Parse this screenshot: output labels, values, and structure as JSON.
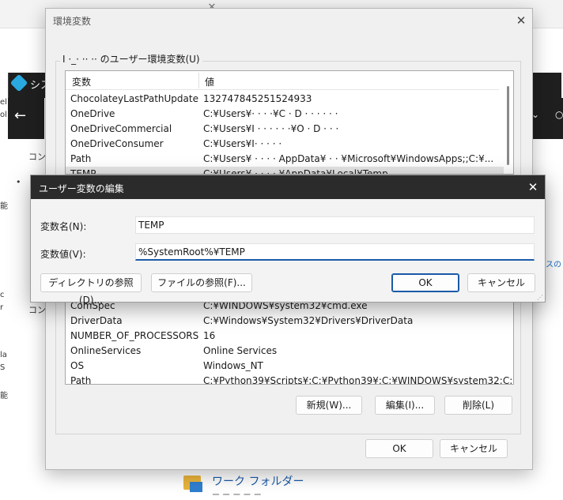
{
  "background": {
    "system_title": "シス",
    "link_con": "コン",
    "link_con2": "コン",
    "bullet": "•",
    "right_link": "スの",
    "edge_texts": [
      "el",
      "ol",
      "能",
      "c",
      "r",
      "la",
      "S",
      "能"
    ],
    "work_folder": "ワーク フォルダー",
    "work_folder_sub": "ー ー ー ー ー"
  },
  "env_dialog": {
    "title": "環境変数",
    "user_group_label": "I ·_· ·· ·· のユーザー環境変数(U)",
    "user_columns": {
      "name": "変数",
      "value": "値"
    },
    "user_vars": [
      {
        "name": "ChocolateyLastPathUpdate",
        "value": "132747845251524933"
      },
      {
        "name": "OneDrive",
        "value": "C:¥Users¥·   ·   ·  ·¥C ·  D · ·  · ·  ·  ·"
      },
      {
        "name": "OneDriveCommercial",
        "value": "C:¥Users¥I · ·  · ·  · ·¥O · D ·  ·  ·"
      },
      {
        "name": "OneDriveConsumer",
        "value": "C:¥Users¥I· ·  ·  ·  ·"
      },
      {
        "name": "Path",
        "value": "C:¥Users¥ ·  · ·  · AppData¥ · ·  ¥Microsoft¥WindowsApps;;C:¥..."
      },
      {
        "name": "TEMP",
        "value": "C:¥Users¥ ·  · ·  · ¥AppData¥Local¥Temp"
      }
    ],
    "system_vars": [
      {
        "name": "ComSpec",
        "value": "C:¥WINDOWS¥system32¥cmd.exe"
      },
      {
        "name": "DriverData",
        "value": "C:¥Windows¥System32¥Drivers¥DriverData"
      },
      {
        "name": "NUMBER_OF_PROCESSORS",
        "value": "16"
      },
      {
        "name": "OnlineServices",
        "value": "Online Services"
      },
      {
        "name": "OS",
        "value": "Windows_NT"
      },
      {
        "name": "Path",
        "value": "C:¥Python39¥Scripts¥;C:¥Python39¥;C:¥WINDOWS¥system32;C:¥WI..."
      }
    ],
    "buttons": {
      "new": "新規(W)...",
      "edit": "編集(I)...",
      "delete": "削除(L)",
      "ok": "OK",
      "cancel": "キャンセル"
    }
  },
  "edit_dialog": {
    "title": "ユーザー変数の編集",
    "name_label": "変数名(N):",
    "value_label": "変数値(V):",
    "name_value": "TEMP",
    "value_value": "%SystemRoot%¥TEMP",
    "buttons": {
      "browse_dir": "ディレクトリの参照(D)...",
      "browse_file": "ファイルの参照(F)...",
      "ok": "OK",
      "cancel": "キャンセル"
    }
  }
}
